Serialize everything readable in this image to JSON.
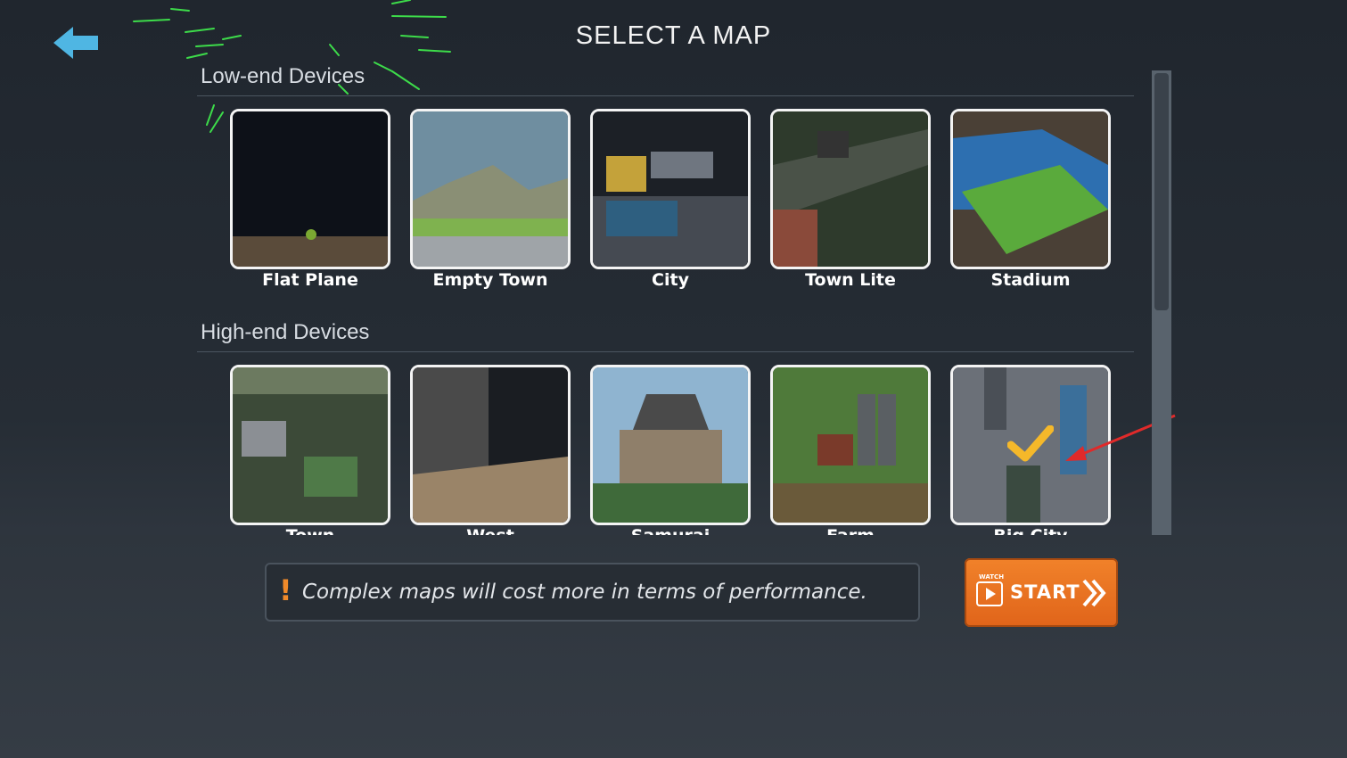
{
  "header": {
    "title": "SELECT A MAP",
    "back_icon": "arrow-left-icon"
  },
  "sections": [
    {
      "label": "Low-end Devices",
      "maps": [
        {
          "name": "Flat Plane"
        },
        {
          "name": "Empty Town"
        },
        {
          "name": "City"
        },
        {
          "name": "Town Lite"
        },
        {
          "name": "Stadium"
        }
      ]
    },
    {
      "label": "High-end Devices",
      "maps": [
        {
          "name": "Town"
        },
        {
          "name": "West"
        },
        {
          "name": "Samurai"
        },
        {
          "name": "Farm"
        },
        {
          "name": "Big City",
          "selected": true
        }
      ]
    }
  ],
  "notice": {
    "icon": "!",
    "text": "Complex maps will cost more in terms of performance."
  },
  "start_button": {
    "watch_label": "WATCH",
    "label": "START",
    "icon": "play-video-icon",
    "arrow_icon": "double-chevron-right-icon"
  },
  "colors": {
    "accent_orange": "#f08a2a",
    "back_arrow": "#4fb6e3",
    "selected_check": "#f5b82a"
  }
}
